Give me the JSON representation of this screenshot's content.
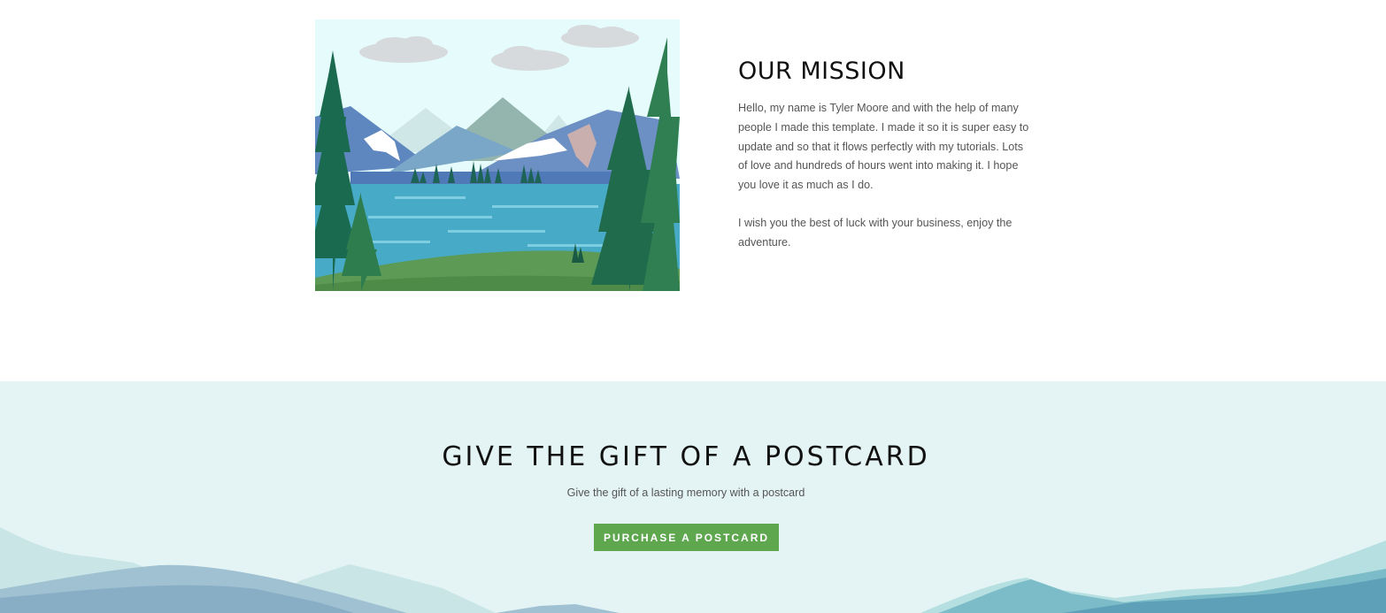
{
  "mission": {
    "title": "OUR MISSION",
    "paragraph_1": "Hello, my name is Tyler Moore and with the help of many people I made this template. I made it so it is super easy to update and so that it flows perfectly with my tutorials. Lots of love and hundreds of hours went into making it. I hope you love it as much as I do.",
    "paragraph_2": "I wish you the best of luck with your business, enjoy the adventure."
  },
  "gift": {
    "title": "GIVE THE GIFT OF A POSTCARD",
    "subtitle": "Give the gift of a lasting memory with a postcard",
    "button_label": "PURCHASE A POSTCARD"
  },
  "colors": {
    "accent": "#5ea74e",
    "gift_background": "#e4f4f4",
    "heading": "#111111",
    "body_text": "#555555"
  }
}
